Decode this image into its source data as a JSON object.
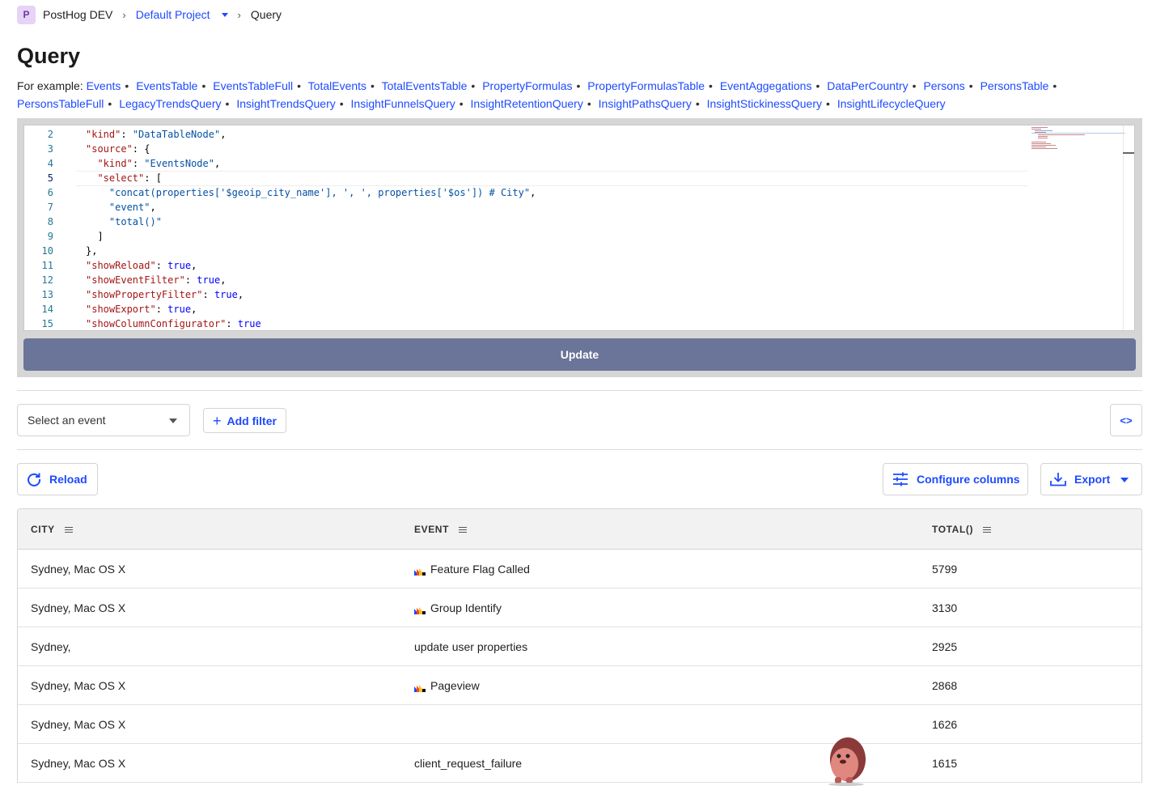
{
  "breadcrumb": {
    "badge": "P",
    "org": "PostHog DEV",
    "sep1": "›",
    "project": "Default Project",
    "sep2": "›",
    "current": "Query"
  },
  "page": {
    "title": "Query"
  },
  "examples": {
    "prefix": "For example: ",
    "separator": "•",
    "links": [
      "Events",
      "EventsTable",
      "EventsTableFull",
      "TotalEvents",
      "TotalEventsTable",
      "PropertyFormulas",
      "PropertyFormulasTable",
      "EventAggegations",
      "DataPerCountry",
      "Persons",
      "PersonsTable",
      "PersonsTableFull",
      "LegacyTrendsQuery",
      "InsightTrendsQuery",
      "InsightFunnelsQuery",
      "InsightRetentionQuery",
      "InsightPathsQuery",
      "InsightStickinessQuery",
      "InsightLifecycleQuery"
    ]
  },
  "editor": {
    "active_line": 5,
    "lines": [
      {
        "n": "2",
        "text": "\"kind\": \"DataTableNode\","
      },
      {
        "n": "3",
        "text": "\"source\": {"
      },
      {
        "n": "4",
        "text": "  \"kind\": \"EventsNode\","
      },
      {
        "n": "5",
        "text": "  \"select\": ["
      },
      {
        "n": "6",
        "text": "    \"concat(properties['$geoip_city_name'], ', ', properties['$os']) # City\","
      },
      {
        "n": "7",
        "text": "    \"event\","
      },
      {
        "n": "8",
        "text": "    \"total()\""
      },
      {
        "n": "9",
        "text": "  ]"
      },
      {
        "n": "10",
        "text": "},"
      },
      {
        "n": "11",
        "text": "\"showReload\": true,"
      },
      {
        "n": "12",
        "text": "\"showEventFilter\": true,"
      },
      {
        "n": "13",
        "text": "\"showPropertyFilter\": true,"
      },
      {
        "n": "14",
        "text": "\"showExport\": true,"
      },
      {
        "n": "15",
        "text": "\"showColumnConfigurator\": true"
      }
    ],
    "update_label": "Update"
  },
  "filters": {
    "event_select": "Select an event",
    "add_filter": "Add filter",
    "code_toggle": "<>"
  },
  "actions": {
    "reload": "Reload",
    "configure_columns": "Configure columns",
    "export": "Export"
  },
  "table": {
    "columns": [
      "CITY",
      "EVENT",
      "TOTAL()"
    ],
    "rows": [
      {
        "city": "Sydney, Mac OS X",
        "event": "Feature Flag Called",
        "ph_icon": true,
        "total": "5799"
      },
      {
        "city": "Sydney, Mac OS X",
        "event": "Group Identify",
        "ph_icon": true,
        "total": "3130"
      },
      {
        "city": "Sydney,",
        "event": "update user properties",
        "ph_icon": false,
        "total": "2925"
      },
      {
        "city": "Sydney, Mac OS X",
        "event": "Pageview",
        "ph_icon": true,
        "total": "2868"
      },
      {
        "city": "Sydney, Mac OS X",
        "event": "",
        "ph_icon": false,
        "total": "1626"
      },
      {
        "city": "Sydney, Mac OS X",
        "event": "client_request_failure",
        "ph_icon": false,
        "total": "1615"
      }
    ]
  },
  "colors": {
    "accent": "#1d4aff",
    "update_button": "#6b7599",
    "json_key": "#a31515",
    "json_string": "#0451a5",
    "line_number": "#237893"
  },
  "icons": {
    "reload": "reload-icon",
    "configure": "sliders-icon",
    "export": "download-icon",
    "event_type": "posthog-logo-icon",
    "mascot": "hedgehog-icon"
  }
}
